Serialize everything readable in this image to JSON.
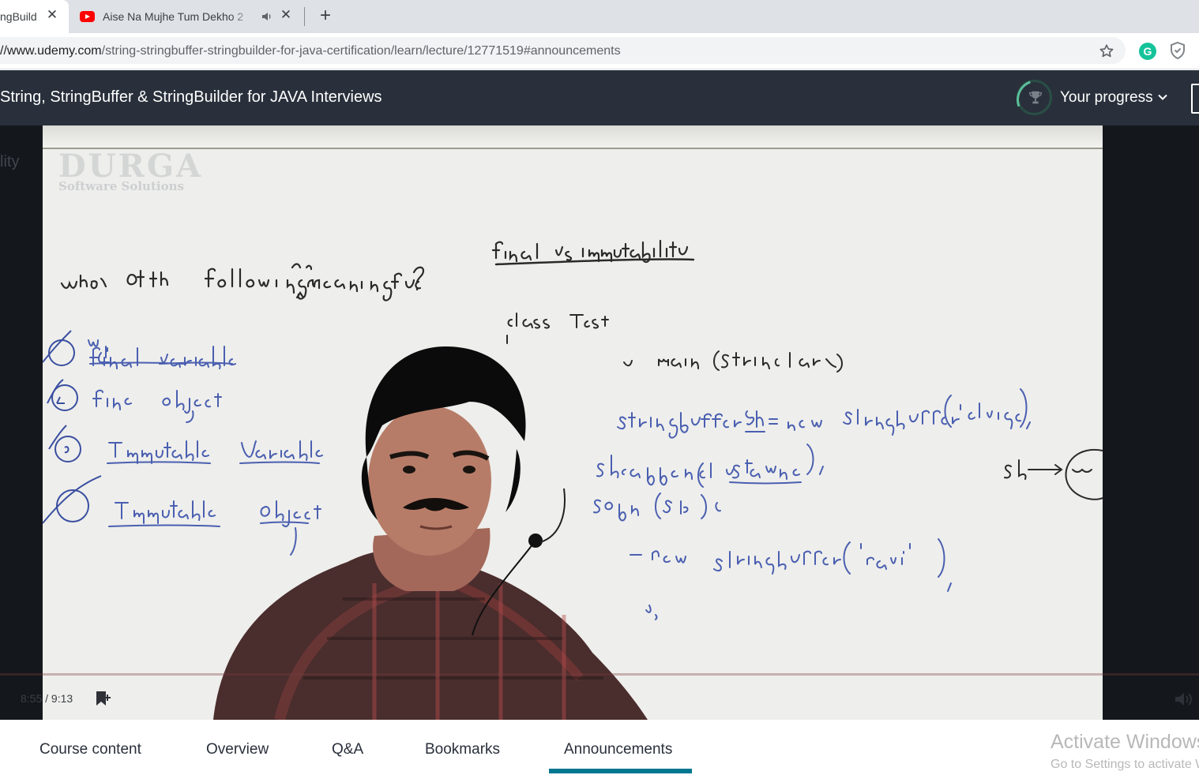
{
  "browser": {
    "tabs": [
      {
        "title": "ngBuild",
        "active": true
      },
      {
        "title": "Aise Na Mujhe Tum Dekho 2",
        "icon": "youtube-icon",
        "audio": true,
        "active": false
      }
    ],
    "address": {
      "host": "//www.udemy.com",
      "path": "/string-stringbuffer-stringbuilder-for-java-certification/learn/lecture/12771519#announcements"
    },
    "extensions": [
      "grammarly-icon",
      "shield-icon"
    ]
  },
  "header": {
    "course_title": "String, StringBuffer & StringBuilder for JAVA Interviews",
    "progress_label": "Your progress"
  },
  "sidebar_fragment": "lity",
  "video": {
    "watermark_title": "DURGA",
    "watermark_subtitle": "Software Solutions",
    "time": "8:55 / 9:13"
  },
  "tabs": [
    "Course content",
    "Overview",
    "Q&A",
    "Bookmarks",
    "Announcements"
  ],
  "active_tab": "Announcements",
  "windows_notice": {
    "line1": "Activate Windows",
    "line2": "Go to Settings to activate Windows."
  },
  "colors": {
    "header_bg": "#29303b",
    "accent": "#007791",
    "progress_ring": "#5bc09a"
  }
}
